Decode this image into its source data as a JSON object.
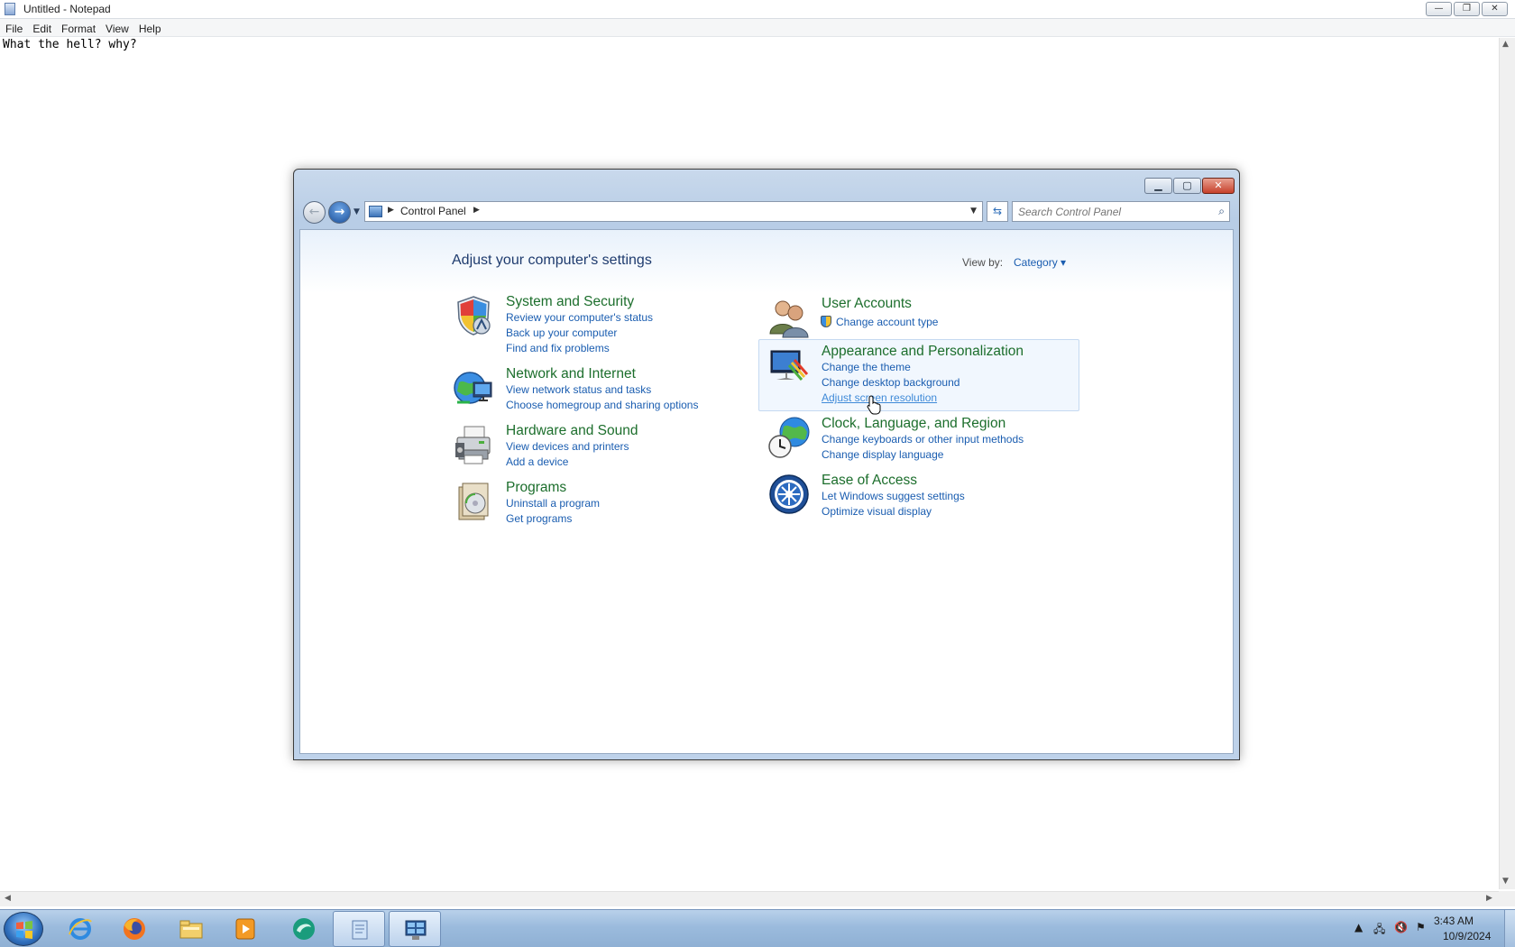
{
  "notepad": {
    "title": "Untitled - Notepad",
    "menu": [
      "File",
      "Edit",
      "Format",
      "View",
      "Help"
    ],
    "text": "What the hell? why?",
    "minimize_glyph": "—",
    "maximize_glyph": "❐",
    "close_glyph": "✕"
  },
  "control_panel": {
    "breadcrumb": "Control Panel",
    "search_placeholder": "Search Control Panel",
    "heading": "Adjust your computer's settings",
    "view_by_label": "View by:",
    "view_by_value": "Category ▾",
    "categories": [
      {
        "title": "System and Security",
        "links": [
          "Review your computer's status",
          "Back up your computer",
          "Find and fix problems"
        ],
        "icon": "shield-icon"
      },
      {
        "title": "Network and Internet",
        "links": [
          "View network status and tasks",
          "Choose homegroup and sharing options"
        ],
        "icon": "network-globe-icon"
      },
      {
        "title": "Hardware and Sound",
        "links": [
          "View devices and printers",
          "Add a device"
        ],
        "icon": "printer-icon"
      },
      {
        "title": "Programs",
        "links": [
          "Uninstall a program",
          "Get programs"
        ],
        "icon": "programs-box-icon"
      },
      {
        "title": "User Accounts",
        "links": [
          "Change account type"
        ],
        "icon": "users-icon"
      },
      {
        "title": "Appearance and Personalization",
        "links": [
          "Change the theme",
          "Change desktop background",
          "Adjust screen resolution"
        ],
        "icon": "monitor-paint-icon"
      },
      {
        "title": "Clock, Language, and Region",
        "links": [
          "Change keyboards or other input methods",
          "Change display language"
        ],
        "icon": "clock-globe-icon"
      },
      {
        "title": "Ease of Access",
        "links": [
          "Let Windows suggest settings",
          "Optimize visual display"
        ],
        "icon": "ease-of-access-icon"
      }
    ],
    "accent_color": "#1a5db0",
    "category_title_color": "#1c6e2c"
  },
  "taskbar": {
    "time": "3:43 AM",
    "date": "10/9/2024",
    "apps": [
      "internet-explorer-icon",
      "firefox-icon",
      "file-explorer-icon",
      "media-player-icon",
      "app-icon",
      "notepad-icon",
      "control-panel-icon"
    ]
  }
}
